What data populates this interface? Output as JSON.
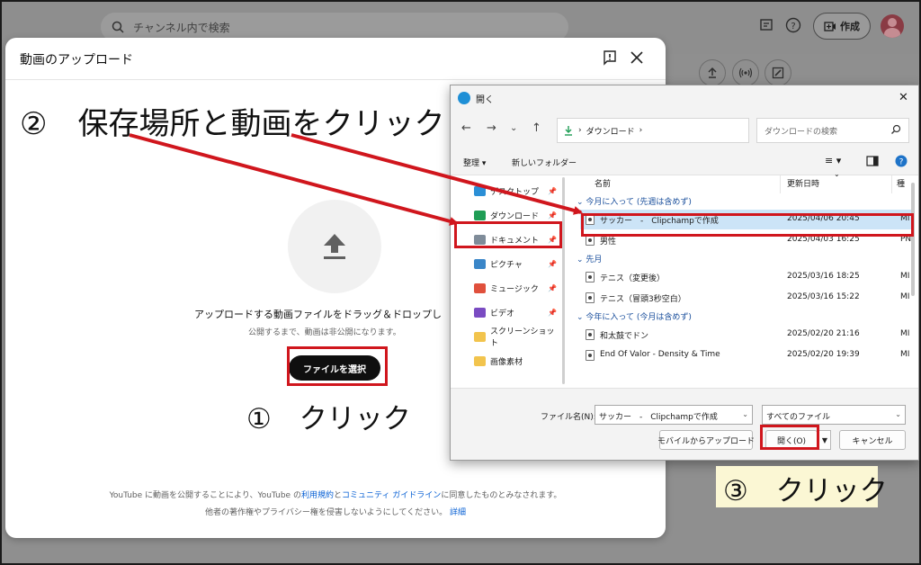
{
  "youtube_header": {
    "search_placeholder": "チャンネル内で検索",
    "create_label": "作成"
  },
  "upload_dialog": {
    "title": "動画のアップロード",
    "drag_text": "アップロードする動画ファイルをドラッグ＆ドロップし",
    "private_note": "公開するまで、動画は非公開になります。",
    "select_button": "ファイルを選択",
    "terms_prefix": "YouTube に動画を公開することにより、YouTube の",
    "terms_link": "利用規約",
    "terms_and": "と",
    "guidelines_link": "コミュニティ ガイドライン",
    "terms_suffix": "に同意したものとみなされます。",
    "rights_text": "他者の著作権やプライバシー権を侵害しないようにしてください。",
    "details_link": "詳細"
  },
  "annotations": {
    "step1": "①　クリック",
    "step2": "②　保存場所と動画をクリック",
    "step3": "③　クリック"
  },
  "open_dialog": {
    "title": "開く",
    "address": "ダウンロード",
    "address_chevron": "›",
    "search_placeholder": "ダウンロードの検索",
    "toolbar": {
      "organize": "整理 ▾",
      "new_folder": "新しいフォルダー"
    },
    "nav_items": [
      {
        "label": "デスクトップ",
        "color": "#2b8fd6"
      },
      {
        "label": "ダウンロード",
        "color": "#1f9d55"
      },
      {
        "label": "ドキュメント",
        "color": "#7f8c99"
      },
      {
        "label": "ピクチャ",
        "color": "#3a86c8"
      },
      {
        "label": "ミュージック",
        "color": "#e0503c"
      },
      {
        "label": "ビデオ",
        "color": "#7a4bc2"
      },
      {
        "label": "スクリーンショット",
        "color": "#f2c44d"
      },
      {
        "label": "画像素材",
        "color": "#f2c44d"
      }
    ],
    "columns": {
      "name": "名前",
      "modified": "更新日時",
      "type": "種"
    },
    "groups": [
      {
        "label": "今月に入って (先週は含めず)",
        "files": [
          {
            "name": "サッカー　-　Clipchampで作成",
            "date": "2025/04/06 20:45",
            "type": "MI"
          },
          {
            "name": "男性",
            "date": "2025/04/03 16:25",
            "type": "PN"
          }
        ]
      },
      {
        "label": "先月",
        "files": [
          {
            "name": "テニス（変更後）",
            "date": "2025/03/16 18:25",
            "type": "MI"
          },
          {
            "name": "テニス（冒頭3秒空白）",
            "date": "2025/03/16 15:22",
            "type": "MI"
          }
        ]
      },
      {
        "label": "今年に入って (今月は含めず)",
        "files": [
          {
            "name": "和太鼓でドン",
            "date": "2025/02/20 21:16",
            "type": "MI"
          },
          {
            "name": "End Of Valor - Density & Time",
            "date": "2025/02/20 19:39",
            "type": "MI"
          }
        ]
      }
    ],
    "filename_label": "ファイル名(N):",
    "filename_value": "サッカー　-　Clipchampで作成",
    "filetype_value": "すべてのファイル",
    "mobile_button": "モバイルからアップロード",
    "open_button": "開く(O)",
    "cancel_button": "キャンセル"
  },
  "colors": {
    "callout_red": "#d0161d",
    "selection_blue": "#cce4f7",
    "note_yellow": "#fbf7d4"
  }
}
